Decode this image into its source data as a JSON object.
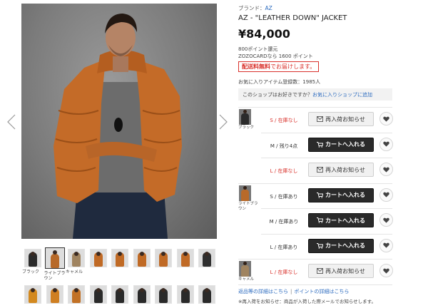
{
  "gallery": {
    "prev_icon": "chevron-left-icon",
    "next_icon": "chevron-right-icon",
    "thumbnails_row1": [
      {
        "label": "ブラック",
        "color": "#2b2b2b",
        "active": false
      },
      {
        "label": "ライトブラウン",
        "color": "#b86a2a",
        "active": true
      },
      {
        "label": "キャメル",
        "color": "#a08460",
        "active": false
      },
      {
        "label": "",
        "color": "#c06a25",
        "active": false
      },
      {
        "label": "",
        "color": "#c06a25",
        "active": false
      },
      {
        "label": "",
        "color": "#c06a25",
        "active": false
      },
      {
        "label": "",
        "color": "#c06a25",
        "active": false
      },
      {
        "label": "",
        "color": "#c06a25",
        "active": false
      },
      {
        "label": "",
        "color": "#2f2f2f",
        "active": false
      }
    ],
    "thumbnails_row2": [
      {
        "label": "",
        "color": "#d3891f",
        "active": false
      },
      {
        "label": "",
        "color": "#cf7f22",
        "active": false
      },
      {
        "label": "",
        "color": "#c27125",
        "active": false
      },
      {
        "label": "",
        "color": "#2a2a2a",
        "active": false
      },
      {
        "label": "",
        "color": "#2a2a2a",
        "active": false
      },
      {
        "label": "",
        "color": "#2a2a2a",
        "active": false
      },
      {
        "label": "",
        "color": "#2a2a2a",
        "active": false
      },
      {
        "label": "",
        "color": "#2a2a2a",
        "active": false
      },
      {
        "label": "",
        "color": "#2a2a2a",
        "active": false
      }
    ]
  },
  "product": {
    "brand_label": "ブランド：",
    "brand_name": "AZ",
    "title": "AZ - \"LEATHER DOWN\" JACKET",
    "price": "¥84,000",
    "points_line1": "800ポイント還元",
    "points_line2": "ZOZOCARDなら 1600 ポイント",
    "shipping_bold": "配送料無料",
    "shipping_rest": "でお届けします。",
    "favorite_count": "お気に入りアイテム登録数：1985人",
    "shop_question": "このショップはお好きですか？",
    "shop_link": "お気に入りショップに追加"
  },
  "variants": [
    {
      "color_name": "ブラック",
      "thumb_color": "#2b2b2b",
      "size": "S / 在庫なし",
      "in_stock": false,
      "button": "再入荷お知らせ",
      "first": true
    },
    {
      "color_name": "",
      "thumb_color": "",
      "size": "M / 残り4点",
      "in_stock": true,
      "button": "カートへ入れる",
      "first": false
    },
    {
      "color_name": "",
      "thumb_color": "",
      "size": "L / 在庫なし",
      "in_stock": false,
      "button": "再入荷お知らせ",
      "first": false
    },
    {
      "color_name": "ライトブラウン",
      "thumb_color": "#b86a2a",
      "size": "S / 在庫あり",
      "in_stock": true,
      "button": "カートへ入れる",
      "first": true
    },
    {
      "color_name": "",
      "thumb_color": "",
      "size": "M / 在庫あり",
      "in_stock": true,
      "button": "カートへ入れる",
      "first": false
    },
    {
      "color_name": "",
      "thumb_color": "",
      "size": "L / 在庫あり",
      "in_stock": true,
      "button": "カートへ入れる",
      "first": false
    },
    {
      "color_name": "キャメル",
      "thumb_color": "#a08460",
      "size": "L / 在庫なし",
      "in_stock": false,
      "button": "再入荷お知らせ",
      "first": true
    }
  ],
  "footer": {
    "link_return": "返品等の詳細はこちら",
    "separator": "|",
    "link_points": "ポイントの詳細はこちら",
    "note": "※再入荷をお知らせ：商品が入荷した際メールでお知らせします。"
  },
  "colors": {
    "accent_red": "#d9312b",
    "link_blue": "#2c6bbf",
    "cart_button": "#2a2a2a",
    "jacket": "#c46b28"
  }
}
